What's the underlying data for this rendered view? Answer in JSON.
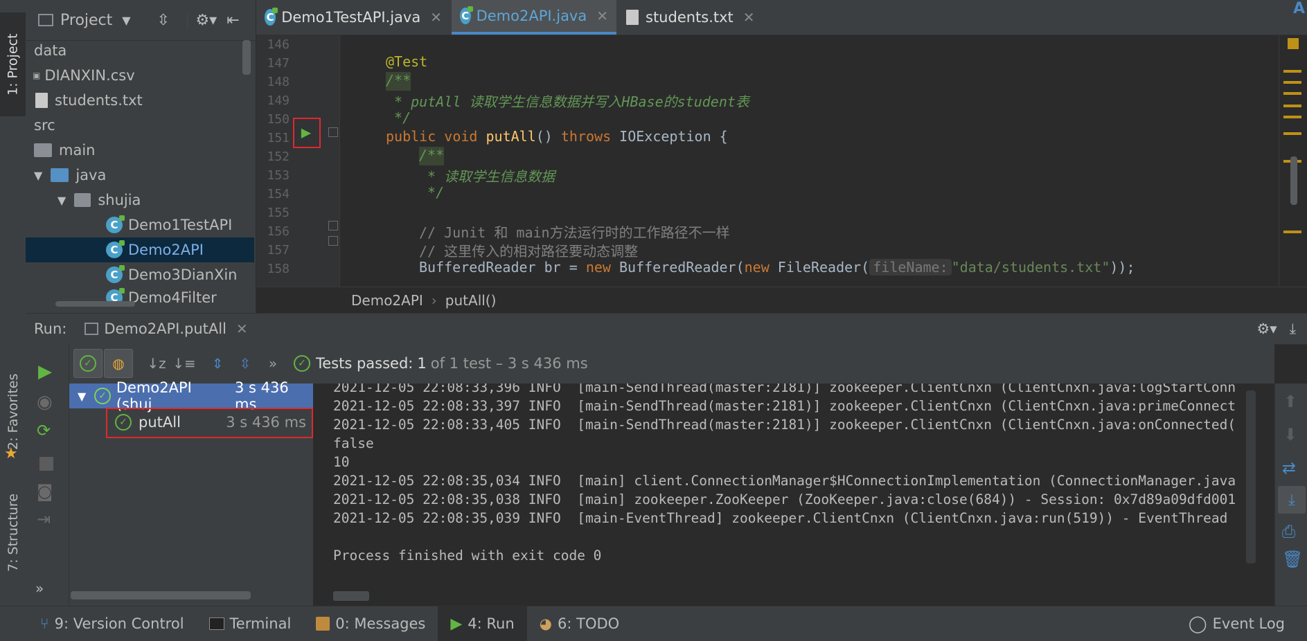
{
  "left_strip": {
    "project_tab": "1: Project",
    "favorites_tab": "2: Favorites",
    "structure_tab": "7: Structure"
  },
  "project_panel": {
    "title": "Project",
    "items": [
      {
        "label": "data",
        "type": "folder"
      },
      {
        "label": "DIANXIN.csv",
        "type": "file"
      },
      {
        "label": "students.txt",
        "type": "file"
      },
      {
        "label": "src",
        "type": "folder"
      },
      {
        "label": "main",
        "type": "folder"
      },
      {
        "label": "java",
        "type": "folder"
      },
      {
        "label": "shujia",
        "type": "package"
      },
      {
        "label": "Demo1TestAPI",
        "type": "class"
      },
      {
        "label": "Demo2API",
        "type": "class",
        "selected": true
      },
      {
        "label": "Demo3DianXin",
        "type": "class"
      },
      {
        "label": "Demo4Filter",
        "type": "class"
      }
    ]
  },
  "editor": {
    "tabs": [
      {
        "label": "Demo1TestAPI.java"
      },
      {
        "label": "Demo2API.java",
        "active": true
      },
      {
        "label": "students.txt"
      }
    ],
    "line_numbers": [
      "146",
      "147",
      "148",
      "149",
      "150",
      "151",
      "152",
      "153",
      "154",
      "155",
      "156",
      "157",
      "158"
    ],
    "code": {
      "l147": "@Test",
      "l148": "/**",
      "l149": " * putAll 读取学生信息数据并写入HBase的student表",
      "l150": " */",
      "l151_kw1": "public",
      "l151_kw2": "void",
      "l151_fn": "putAll",
      "l151_mid": "() ",
      "l151_kw3": "throws",
      "l151_end": " IOException {",
      "l152": "/**",
      "l153": " * 读取学生信息数据",
      "l154": " */",
      "l156": "// Junit 和 main方法运行时的工作路径不一样",
      "l157": "// 这里传入的相对路径要动态调整",
      "l158_a": "BufferedReader br = ",
      "l158_new1": "new",
      "l158_b": " BufferedReader(",
      "l158_new2": "new",
      "l158_c": " FileReader(",
      "l158_hint": "fileName:",
      "l158_str": "\"data/students.txt\"",
      "l158_end": "));"
    },
    "breadcrumb": {
      "class": "Demo2API",
      "sep": "›",
      "method": "putAll()"
    }
  },
  "run_panel": {
    "label": "Run:",
    "tab": "Demo2API.putAll",
    "status_bold": "Tests passed:",
    "status_count": "1",
    "status_rest": "of 1 test – 3 s 436 ms",
    "tree": {
      "root_label": "Demo2API (shuj",
      "root_time": "3 s 436 ms",
      "child_label": "putAll",
      "child_time": "3 s 436 ms"
    },
    "console": [
      "2021-12-05 22:08:33,396 INFO  [main-SendThread(master:2181)] zookeeper.ClientCnxn (ClientCnxn.java:logStartConn",
      "2021-12-05 22:08:33,397 INFO  [main-SendThread(master:2181)] zookeeper.ClientCnxn (ClientCnxn.java:primeConnect",
      "2021-12-05 22:08:33,405 INFO  [main-SendThread(master:2181)] zookeeper.ClientCnxn (ClientCnxn.java:onConnected(",
      "false",
      "10",
      "2021-12-05 22:08:35,034 INFO  [main] client.ConnectionManager$HConnectionImplementation (ConnectionManager.java",
      "2021-12-05 22:08:35,038 INFO  [main] zookeeper.ZooKeeper (ZooKeeper.java:close(684)) - Session: 0x7d89a09dfd001",
      "2021-12-05 22:08:35,039 INFO  [main-EventThread] zookeeper.ClientCnxn (ClientCnxn.java:run(519)) - EventThread",
      "",
      "Process finished with exit code 0"
    ]
  },
  "bottom_bar": {
    "version_control": "9: Version Control",
    "terminal": "Terminal",
    "messages": "0: Messages",
    "run": "4: Run",
    "todo": "6: TODO",
    "event_log": "Event Log"
  },
  "colors": {
    "accent": "#4a88c7",
    "success": "#62b543",
    "highlight_box": "#e0282e"
  }
}
